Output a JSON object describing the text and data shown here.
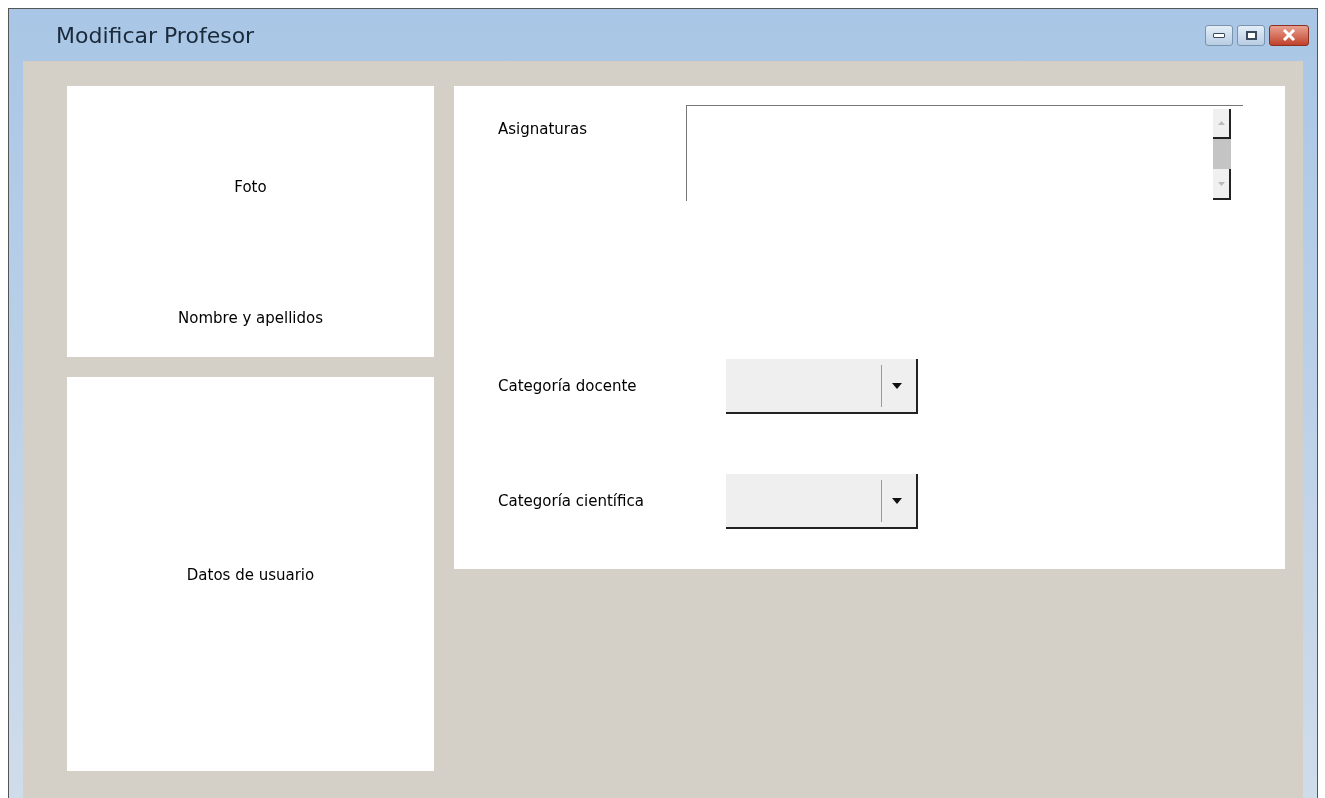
{
  "window": {
    "title": "Modificar Profesor"
  },
  "photo_panel": {
    "photo_label": "Foto",
    "name_label": "Nombre y apellidos"
  },
  "user_panel": {
    "label": "Datos de usuario"
  },
  "subjects": {
    "label": "Asignaturas"
  },
  "categories": [
    {
      "label": "Categoría docente"
    },
    {
      "label": "Categoría científica"
    }
  ]
}
